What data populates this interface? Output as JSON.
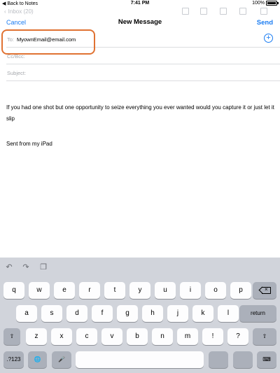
{
  "status_bar": {
    "back_label": "Back to Notes",
    "time": "7:41 PM",
    "battery": "100%",
    "battery_level": 1.0
  },
  "background_toolbar": {
    "inbox_label": "Inbox (20)"
  },
  "compose": {
    "cancel_label": "Cancel",
    "title": "New Message",
    "send_label": "Send",
    "to_label": "To:",
    "to_value": "MyownEmail@email.com",
    "cc_label": "Cc/Bcc:",
    "subject_label": "Subject:",
    "body": "If you had one shot but one opportunity to seize everything you ever wanted would you capture it or just let it slip",
    "signature": "Sent from my iPad"
  },
  "keyboard": {
    "toolbar_icons": [
      "undo-icon",
      "redo-icon",
      "paste-icon"
    ],
    "row1": [
      "q",
      "w",
      "e",
      "r",
      "t",
      "y",
      "u",
      "i",
      "o",
      "p"
    ],
    "row2": [
      "a",
      "s",
      "d",
      "f",
      "g",
      "h",
      "j",
      "k",
      "l"
    ],
    "row3": [
      "z",
      "x",
      "c",
      "v",
      "b",
      "n",
      "m",
      "!",
      "?"
    ],
    "return_label": "return",
    "numbers_label": ".?123",
    "shift_glyph": "⇧",
    "globe_glyph": "🌐",
    "mic_glyph": "🎤",
    "dismiss_glyph": "⌨"
  },
  "colors": {
    "accent": "#1a7cf2",
    "highlight": "#e07232",
    "keyboard_bg": "#d1d4db"
  }
}
